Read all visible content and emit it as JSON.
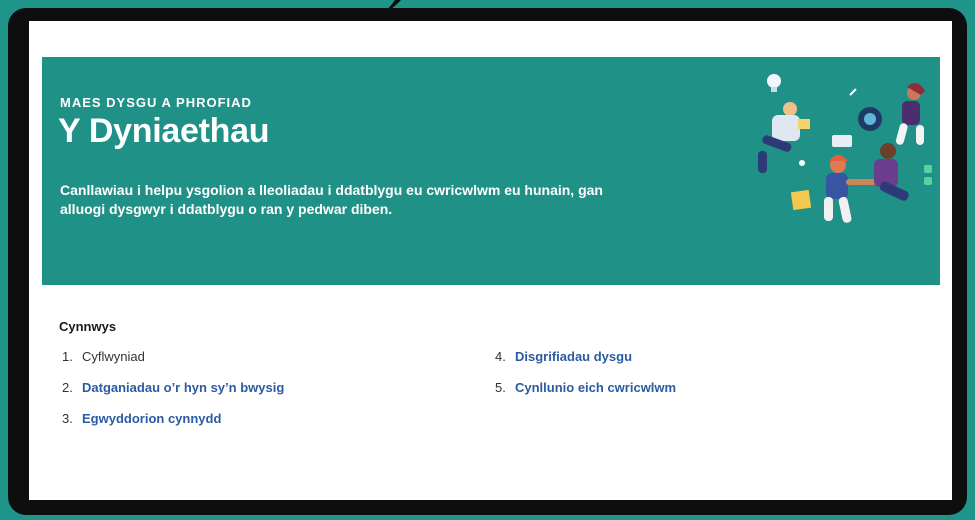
{
  "hero": {
    "overline": "MAES DYSGU A PHROFIAD",
    "title": "Y Dyniaethau",
    "description": "Canllawiau i helpu ysgolion a lleoliadau i ddatblygu eu cwricwlwm eu hunain, gan alluogi dysgwyr i ddatblygu o ran y pedwar diben."
  },
  "toc": {
    "heading": "Cynnwys",
    "left": [
      {
        "num": "1.",
        "label": "Cyflwyniad"
      },
      {
        "num": "2.",
        "label": "Datganiadau o’r hyn sy’n bwysig"
      },
      {
        "num": "3.",
        "label": "Egwyddorion cynnydd"
      }
    ],
    "right": [
      {
        "num": "4.",
        "label": "Disgrifiadau dysgu"
      },
      {
        "num": "5.",
        "label": "Cynllunio eich cwricwlwm"
      }
    ]
  },
  "colors": {
    "teal": "#209187",
    "link": "#2a5ba3",
    "background": "#1f9488"
  }
}
